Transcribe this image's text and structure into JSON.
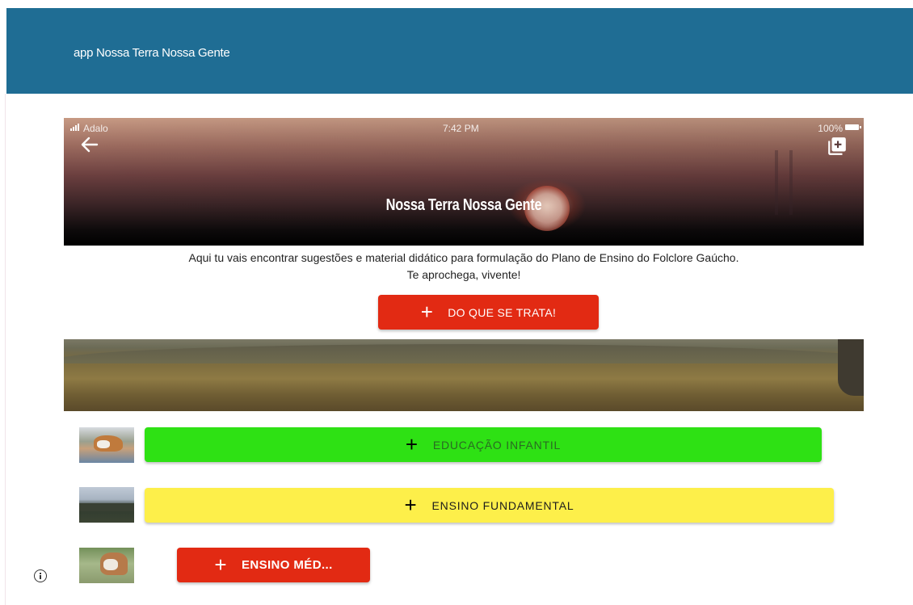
{
  "header": {
    "title": "app Nossa Terra Nossa Gente",
    "background": "#1f6d94"
  },
  "status_bar": {
    "carrier": "Adalo",
    "time": "7:42 PM",
    "battery": "100%"
  },
  "hero": {
    "title": "Nossa Terra Nossa Gente",
    "back_icon": "arrow-left-icon",
    "action_icon": "library-add-icon"
  },
  "intro": {
    "line1": "Aqui tu vais encontrar sugestões e material didático para formulação do Plano de Ensino do Folclore Gaúcho.",
    "line2": "Te aprochega, vivente!"
  },
  "buttons": {
    "trata": {
      "label": "DO QUE SE TRATA!",
      "icon": "plus-icon",
      "color": "#e22a13"
    },
    "infantil": {
      "label": "EDUCAÇÃO INFANTIL",
      "icon": "plus-icon",
      "color": "#2ee114"
    },
    "fundamental": {
      "label": "ENSINO FUNDAMENTAL",
      "icon": "plus-icon",
      "color": "#fdef4a"
    },
    "medio": {
      "label": "ENSINO MÉD...",
      "icon": "plus-icon",
      "color": "#e22a13"
    }
  },
  "footer": {
    "icon": "info-icon"
  }
}
